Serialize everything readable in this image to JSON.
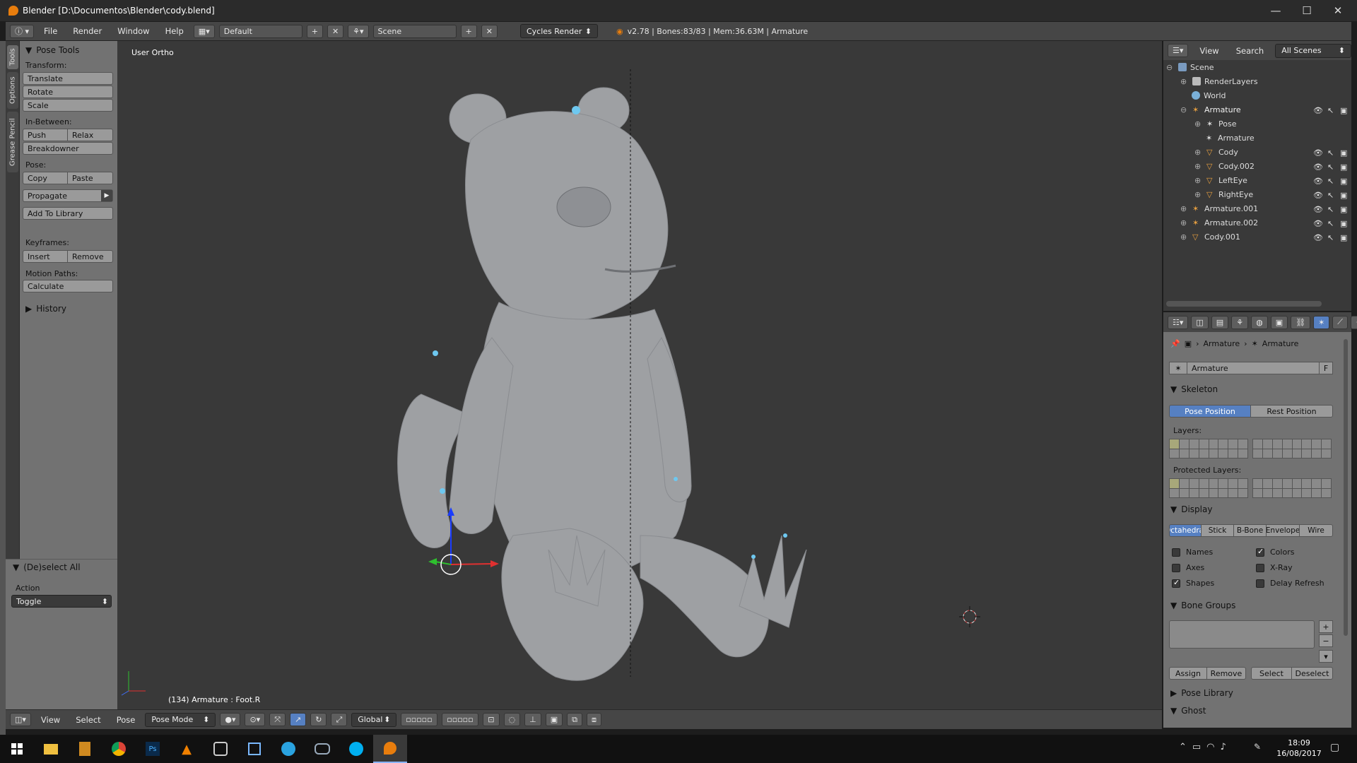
{
  "window": {
    "title": "Blender [D:\\Documentos\\Blender\\cody.blend]"
  },
  "infobar": {
    "menus": [
      "File",
      "Render",
      "Window",
      "Help"
    ],
    "layout": "Default",
    "scene": "Scene",
    "engine": "Cycles Render",
    "stats": "v2.78 | Bones:83/83 | Mem:36.63M | Armature"
  },
  "side_tabs": [
    "Tools",
    "Options",
    "Grease Pencil"
  ],
  "toolshelf": {
    "panel_title": "Pose Tools",
    "transform_label": "Transform:",
    "translate": "Translate",
    "rotate": "Rotate",
    "scale": "Scale",
    "inbetween_label": "In-Between:",
    "push": "Push",
    "relax": "Relax",
    "breakdowner": "Breakdowner",
    "pose_label": "Pose:",
    "copy": "Copy",
    "paste": "Paste",
    "propagate": "Propagate",
    "add_to_library": "Add To Library",
    "keyframes_label": "Keyframes:",
    "insert": "Insert",
    "remove": "Remove",
    "motion_paths_label": "Motion Paths:",
    "calculate": "Calculate",
    "history": "History"
  },
  "redo_panel": {
    "title": "(De)select All",
    "action_label": "Action",
    "action_value": "Toggle"
  },
  "viewport": {
    "view_label": "User Ortho",
    "status": "(134) Armature : Foot.R"
  },
  "view_header": {
    "menus": [
      "View",
      "Select",
      "Pose"
    ],
    "mode": "Pose Mode",
    "orientation": "Global"
  },
  "outliner": {
    "header": {
      "view": "View",
      "search": "Search",
      "filter": "All Scenes"
    },
    "items": [
      {
        "label": "Scene",
        "icon": "scene-icon"
      },
      {
        "label": "RenderLayers",
        "icon": "render-layers-icon"
      },
      {
        "label": "World",
        "icon": "world-icon"
      },
      {
        "label": "Armature",
        "icon": "armature-icon"
      },
      {
        "label": "Pose",
        "icon": "pose-icon"
      },
      {
        "label": "Armature",
        "icon": "armature-data-icon"
      },
      {
        "label": "Cody",
        "icon": "mesh-icon"
      },
      {
        "label": "Cody.002",
        "icon": "mesh-icon"
      },
      {
        "label": "LeftEye",
        "icon": "mesh-icon"
      },
      {
        "label": "RightEye",
        "icon": "mesh-icon"
      },
      {
        "label": "Armature.001",
        "icon": "armature-icon"
      },
      {
        "label": "Armature.002",
        "icon": "armature-icon"
      },
      {
        "label": "Cody.001",
        "icon": "mesh-icon"
      }
    ]
  },
  "properties": {
    "breadcrumb": [
      "Armature",
      "Armature"
    ],
    "datablock_name": "Armature",
    "datablock_flag": "F",
    "skeleton": {
      "title": "Skeleton",
      "pose_position": "Pose Position",
      "rest_position": "Rest Position",
      "layers_label": "Layers:",
      "protected_label": "Protected Layers:"
    },
    "display": {
      "title": "Display",
      "tabs": [
        "Octahedral",
        "Stick",
        "B-Bone",
        "Envelope",
        "Wire"
      ],
      "names": "Names",
      "colors": "Colors",
      "axes": "Axes",
      "xray": "X-Ray",
      "shapes": "Shapes",
      "delay_refresh": "Delay Refresh"
    },
    "bone_groups": {
      "title": "Bone Groups",
      "assign": "Assign",
      "remove": "Remove",
      "select": "Select",
      "deselect": "Deselect"
    },
    "pose_library": "Pose Library",
    "ghost": "Ghost"
  },
  "taskbar": {
    "time": "18:09",
    "date": "16/08/2017"
  },
  "colors": {
    "accent": "#5680c2",
    "blender_orange": "#e87d0d",
    "viewport_bg": "#393939",
    "panel_bg": "#727272"
  }
}
